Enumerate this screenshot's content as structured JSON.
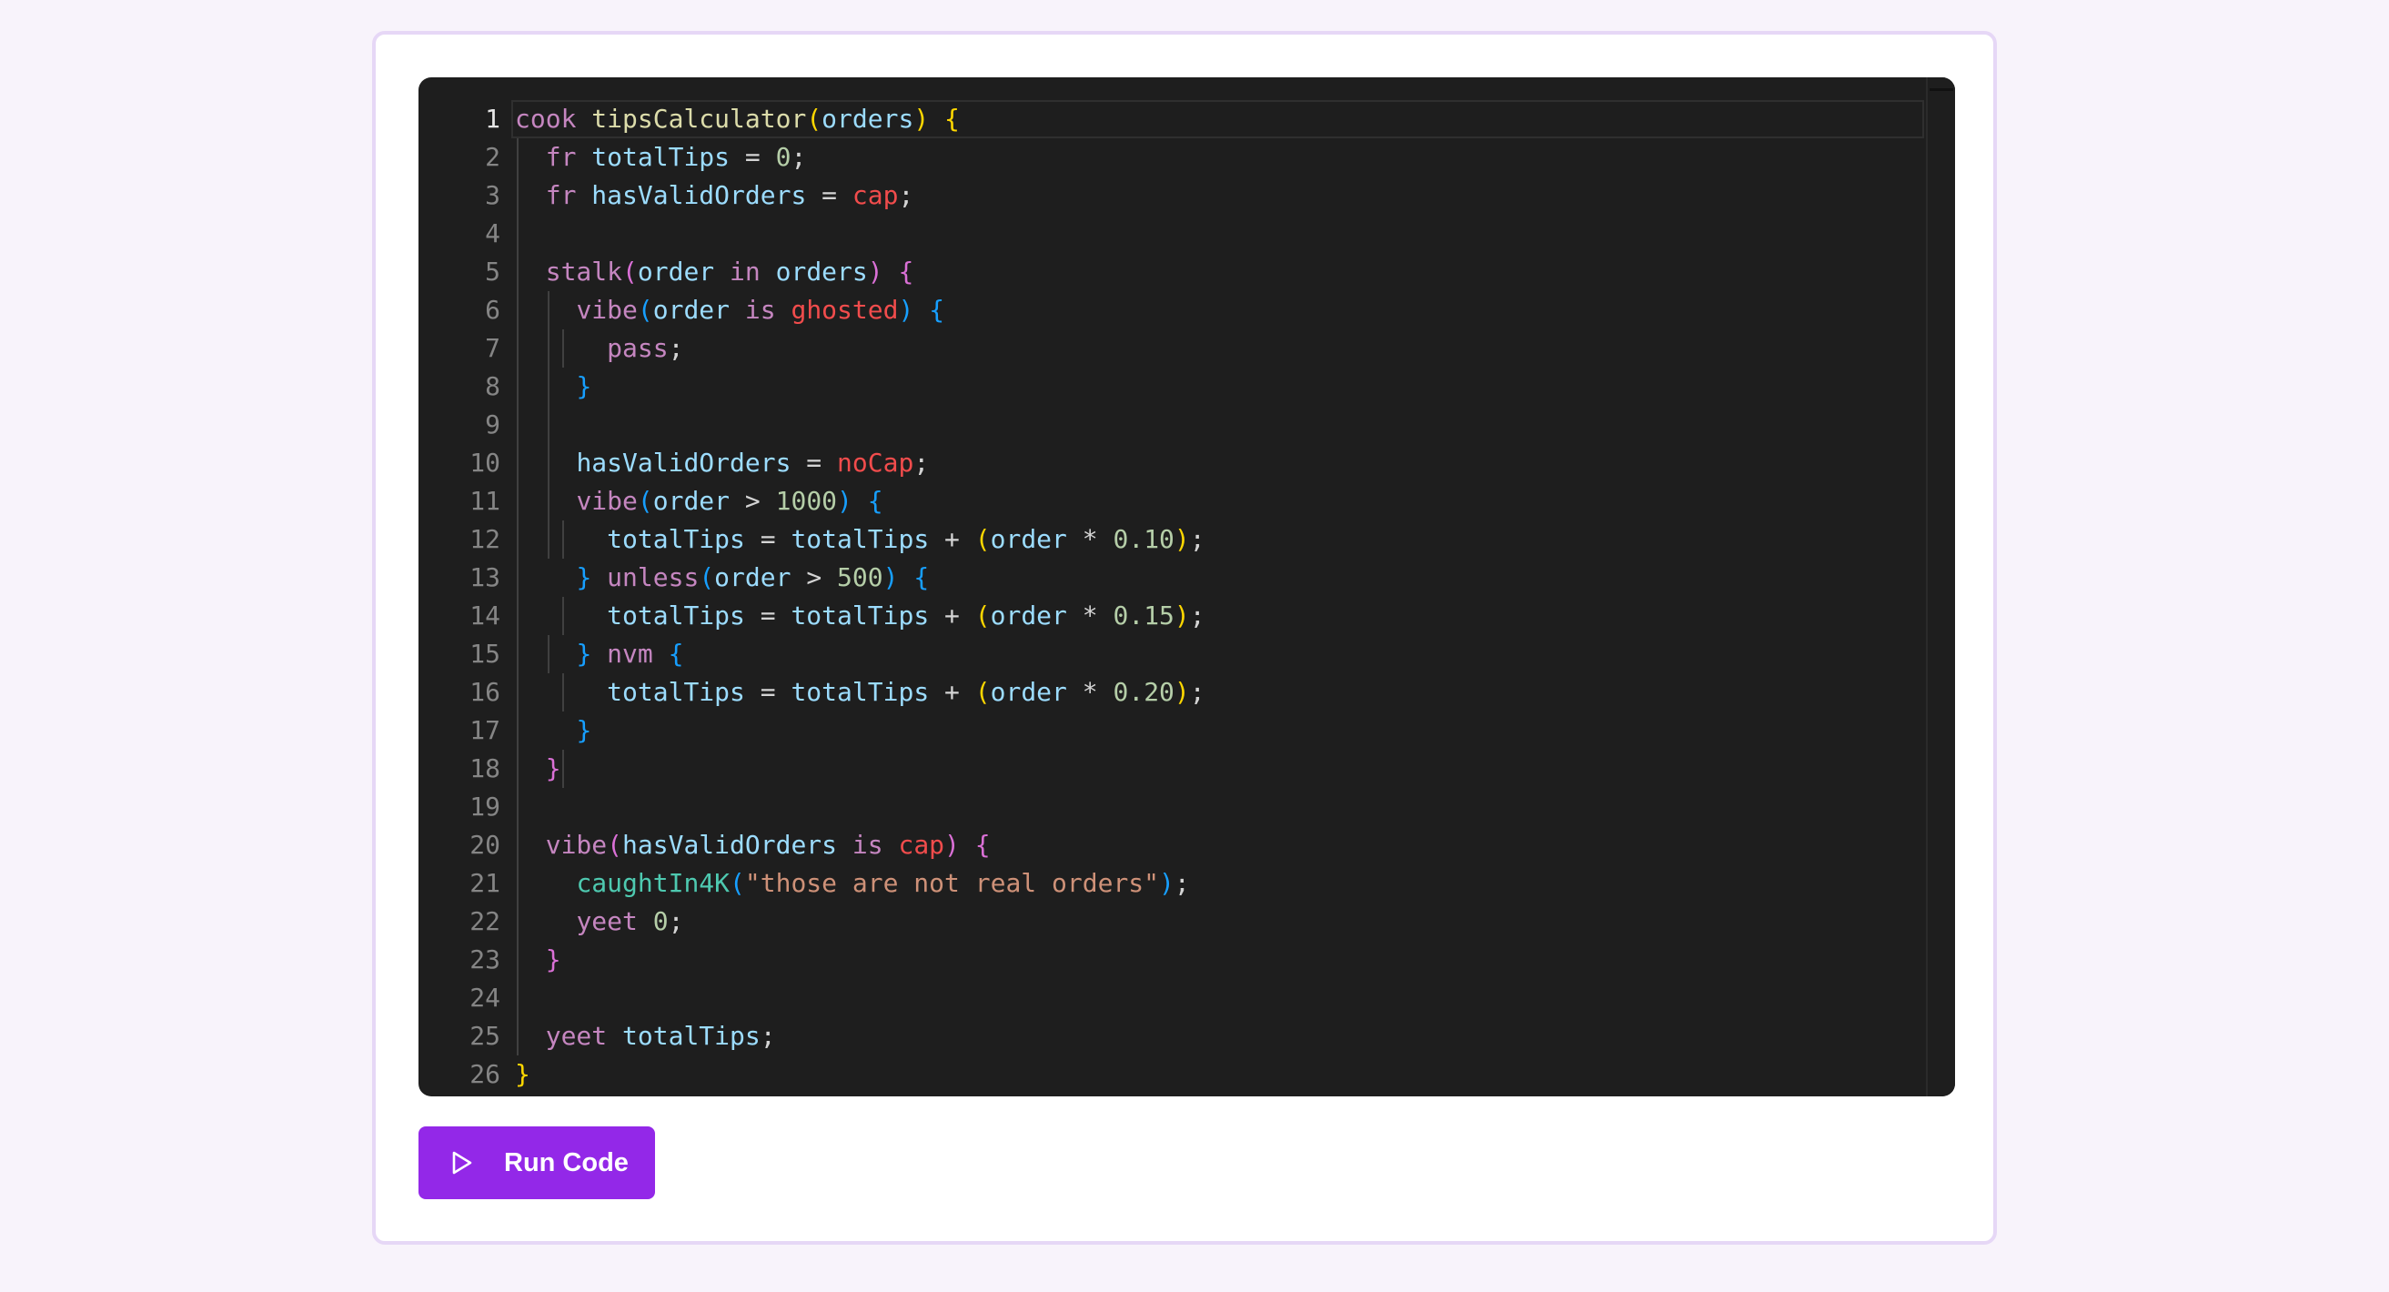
{
  "editor": {
    "active_line": 1,
    "lines": [
      [
        [
          "cook ",
          "kw"
        ],
        [
          "tipsCalculator",
          "fn"
        ],
        [
          "(",
          "b1"
        ],
        [
          "orders",
          "var"
        ],
        [
          ")",
          "b1"
        ],
        [
          " ",
          ""
        ],
        [
          "{",
          "b1"
        ]
      ],
      [
        [
          "  ",
          ""
        ],
        [
          "fr ",
          "kw"
        ],
        [
          "totalTips",
          "var"
        ],
        [
          " = ",
          "op"
        ],
        [
          "0",
          "num"
        ],
        [
          ";",
          "op"
        ]
      ],
      [
        [
          "  ",
          ""
        ],
        [
          "fr ",
          "kw"
        ],
        [
          "hasValidOrders",
          "var"
        ],
        [
          " = ",
          "op"
        ],
        [
          "cap",
          "bool"
        ],
        [
          ";",
          "op"
        ]
      ],
      [],
      [
        [
          "  ",
          ""
        ],
        [
          "stalk",
          "kw"
        ],
        [
          "(",
          "b2"
        ],
        [
          "order",
          "var"
        ],
        [
          " in ",
          "kw"
        ],
        [
          "orders",
          "var"
        ],
        [
          ")",
          "b2"
        ],
        [
          " ",
          ""
        ],
        [
          "{",
          "b2"
        ]
      ],
      [
        [
          "    ",
          ""
        ],
        [
          "vibe",
          "kw"
        ],
        [
          "(",
          "b3"
        ],
        [
          "order",
          "var"
        ],
        [
          " is ",
          "kw"
        ],
        [
          "ghosted",
          "bool"
        ],
        [
          ")",
          "b3"
        ],
        [
          " ",
          ""
        ],
        [
          "{",
          "b3"
        ]
      ],
      [
        [
          "      ",
          ""
        ],
        [
          "pass",
          "kw"
        ],
        [
          ";",
          "op"
        ]
      ],
      [
        [
          "    ",
          ""
        ],
        [
          "}",
          "b3"
        ]
      ],
      [],
      [
        [
          "    ",
          ""
        ],
        [
          "hasValidOrders",
          "var"
        ],
        [
          " = ",
          "op"
        ],
        [
          "noCap",
          "bool"
        ],
        [
          ";",
          "op"
        ]
      ],
      [
        [
          "    ",
          ""
        ],
        [
          "vibe",
          "kw"
        ],
        [
          "(",
          "b3"
        ],
        [
          "order",
          "var"
        ],
        [
          " > ",
          "op"
        ],
        [
          "1000",
          "num"
        ],
        [
          ")",
          "b3"
        ],
        [
          " ",
          ""
        ],
        [
          "{",
          "b3"
        ]
      ],
      [
        [
          "      ",
          ""
        ],
        [
          "totalTips",
          "var"
        ],
        [
          " = ",
          "op"
        ],
        [
          "totalTips",
          "var"
        ],
        [
          " + ",
          "op"
        ],
        [
          "(",
          "b1"
        ],
        [
          "order",
          "var"
        ],
        [
          " * ",
          "op"
        ],
        [
          "0.10",
          "num"
        ],
        [
          ")",
          "b1"
        ],
        [
          ";",
          "op"
        ]
      ],
      [
        [
          "    ",
          ""
        ],
        [
          "}",
          "b3"
        ],
        [
          " unless",
          "kw"
        ],
        [
          "(",
          "b3"
        ],
        [
          "order",
          "var"
        ],
        [
          " > ",
          "op"
        ],
        [
          "500",
          "num"
        ],
        [
          ")",
          "b3"
        ],
        [
          " ",
          ""
        ],
        [
          "{",
          "b3"
        ]
      ],
      [
        [
          "      ",
          ""
        ],
        [
          "totalTips",
          "var"
        ],
        [
          " = ",
          "op"
        ],
        [
          "totalTips",
          "var"
        ],
        [
          " + ",
          "op"
        ],
        [
          "(",
          "b1"
        ],
        [
          "order",
          "var"
        ],
        [
          " * ",
          "op"
        ],
        [
          "0.15",
          "num"
        ],
        [
          ")",
          "b1"
        ],
        [
          ";",
          "op"
        ]
      ],
      [
        [
          "    ",
          ""
        ],
        [
          "}",
          "b3"
        ],
        [
          " nvm ",
          "kw"
        ],
        [
          "{",
          "b3"
        ]
      ],
      [
        [
          "      ",
          ""
        ],
        [
          "totalTips",
          "var"
        ],
        [
          " = ",
          "op"
        ],
        [
          "totalTips",
          "var"
        ],
        [
          " + ",
          "op"
        ],
        [
          "(",
          "b1"
        ],
        [
          "order",
          "var"
        ],
        [
          " * ",
          "op"
        ],
        [
          "0.20",
          "num"
        ],
        [
          ")",
          "b1"
        ],
        [
          ";",
          "op"
        ]
      ],
      [
        [
          "    ",
          ""
        ],
        [
          "}",
          "b3"
        ]
      ],
      [
        [
          "  ",
          ""
        ],
        [
          "}",
          "b2"
        ]
      ],
      [],
      [
        [
          "  ",
          ""
        ],
        [
          "vibe",
          "kw"
        ],
        [
          "(",
          "b2"
        ],
        [
          "hasValidOrders",
          "var"
        ],
        [
          " is ",
          "kw"
        ],
        [
          "cap",
          "bool"
        ],
        [
          ")",
          "b2"
        ],
        [
          " ",
          ""
        ],
        [
          "{",
          "b2"
        ]
      ],
      [
        [
          "    ",
          ""
        ],
        [
          "caughtIn4K",
          "call"
        ],
        [
          "(",
          "b3"
        ],
        [
          "\"those are not real orders\"",
          "str"
        ],
        [
          ")",
          "b3"
        ],
        [
          ";",
          "op"
        ]
      ],
      [
        [
          "    ",
          ""
        ],
        [
          "yeet ",
          "kw"
        ],
        [
          "0",
          "num"
        ],
        [
          ";",
          "op"
        ]
      ],
      [
        [
          "  ",
          ""
        ],
        [
          "}",
          "b2"
        ]
      ],
      [],
      [
        [
          "  ",
          ""
        ],
        [
          "yeet ",
          "kw"
        ],
        [
          "totalTips",
          "var"
        ],
        [
          ";",
          "op"
        ]
      ],
      [
        [
          "}",
          "b1"
        ]
      ]
    ]
  },
  "run_button": {
    "label": "Run Code",
    "icon": "play-icon"
  },
  "colors": {
    "accent": "#9328e8",
    "editor_bg": "#1e1e1e",
    "page_bg": "#f8f3fb"
  }
}
